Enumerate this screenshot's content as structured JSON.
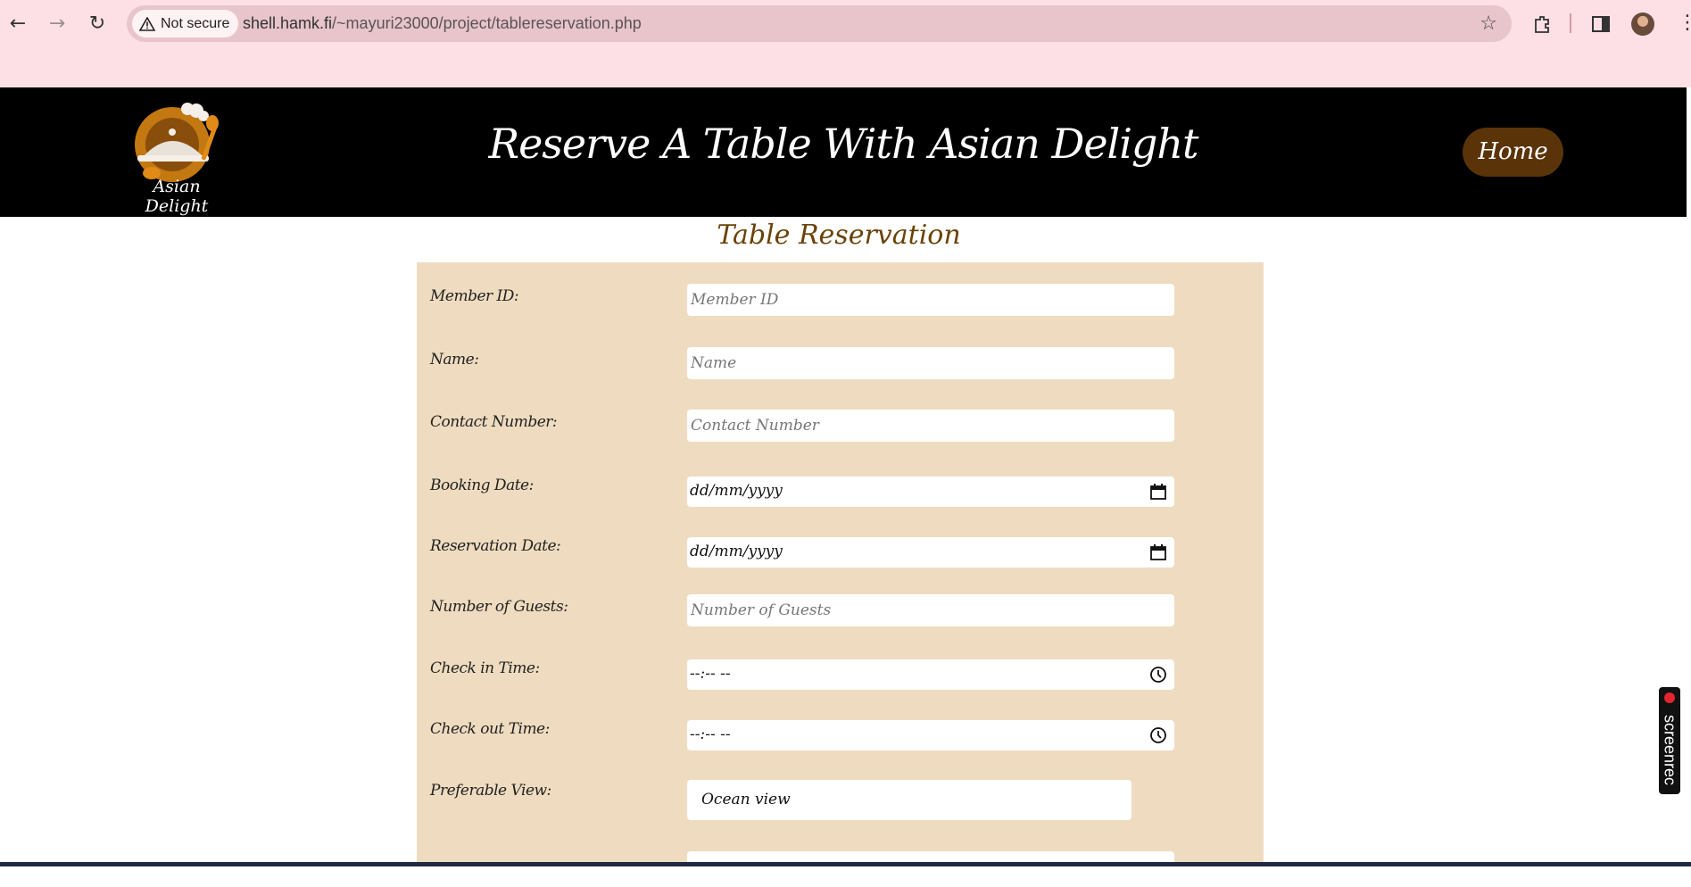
{
  "browser": {
    "security_label": "Not secure",
    "url_host": "shell.hamk.fi",
    "url_path": "/~mayuri23000/project/tablereservation.php"
  },
  "header": {
    "logo_text": "Asian Delight",
    "title": "Reserve A Table With Asian Delight",
    "home_label": "Home"
  },
  "form": {
    "title": "Table Reservation",
    "fields": [
      {
        "label": "Member ID:",
        "placeholder": "Member ID"
      },
      {
        "label": "Name:",
        "placeholder": "Name"
      },
      {
        "label": "Contact Number:",
        "placeholder": "Contact Number"
      },
      {
        "label": "Booking Date:",
        "value": "dd/mm/yyyy"
      },
      {
        "label": "Reservation Date:",
        "value": "dd/mm/yyyy"
      },
      {
        "label": "Number of Guests:",
        "placeholder": "Number of Guests"
      },
      {
        "label": "Check in Time:",
        "value": "--:-- --"
      },
      {
        "label": "Check out Time:",
        "value": "--:-- --"
      },
      {
        "label": "Preferable View:",
        "value": "Ocean view"
      }
    ]
  },
  "overlay": {
    "recorder_label": "screenrec"
  },
  "icons": {
    "calendar": "calendar-icon",
    "clock": "clock-icon",
    "warning": "warning-icon"
  },
  "colors": {
    "page_bg": "#ffffff",
    "chrome_bg": "#fde0e6",
    "header_bg": "#000000",
    "home_button": "#5a3408",
    "title_brown": "#6a4208",
    "form_panel": "#efdcc0"
  }
}
